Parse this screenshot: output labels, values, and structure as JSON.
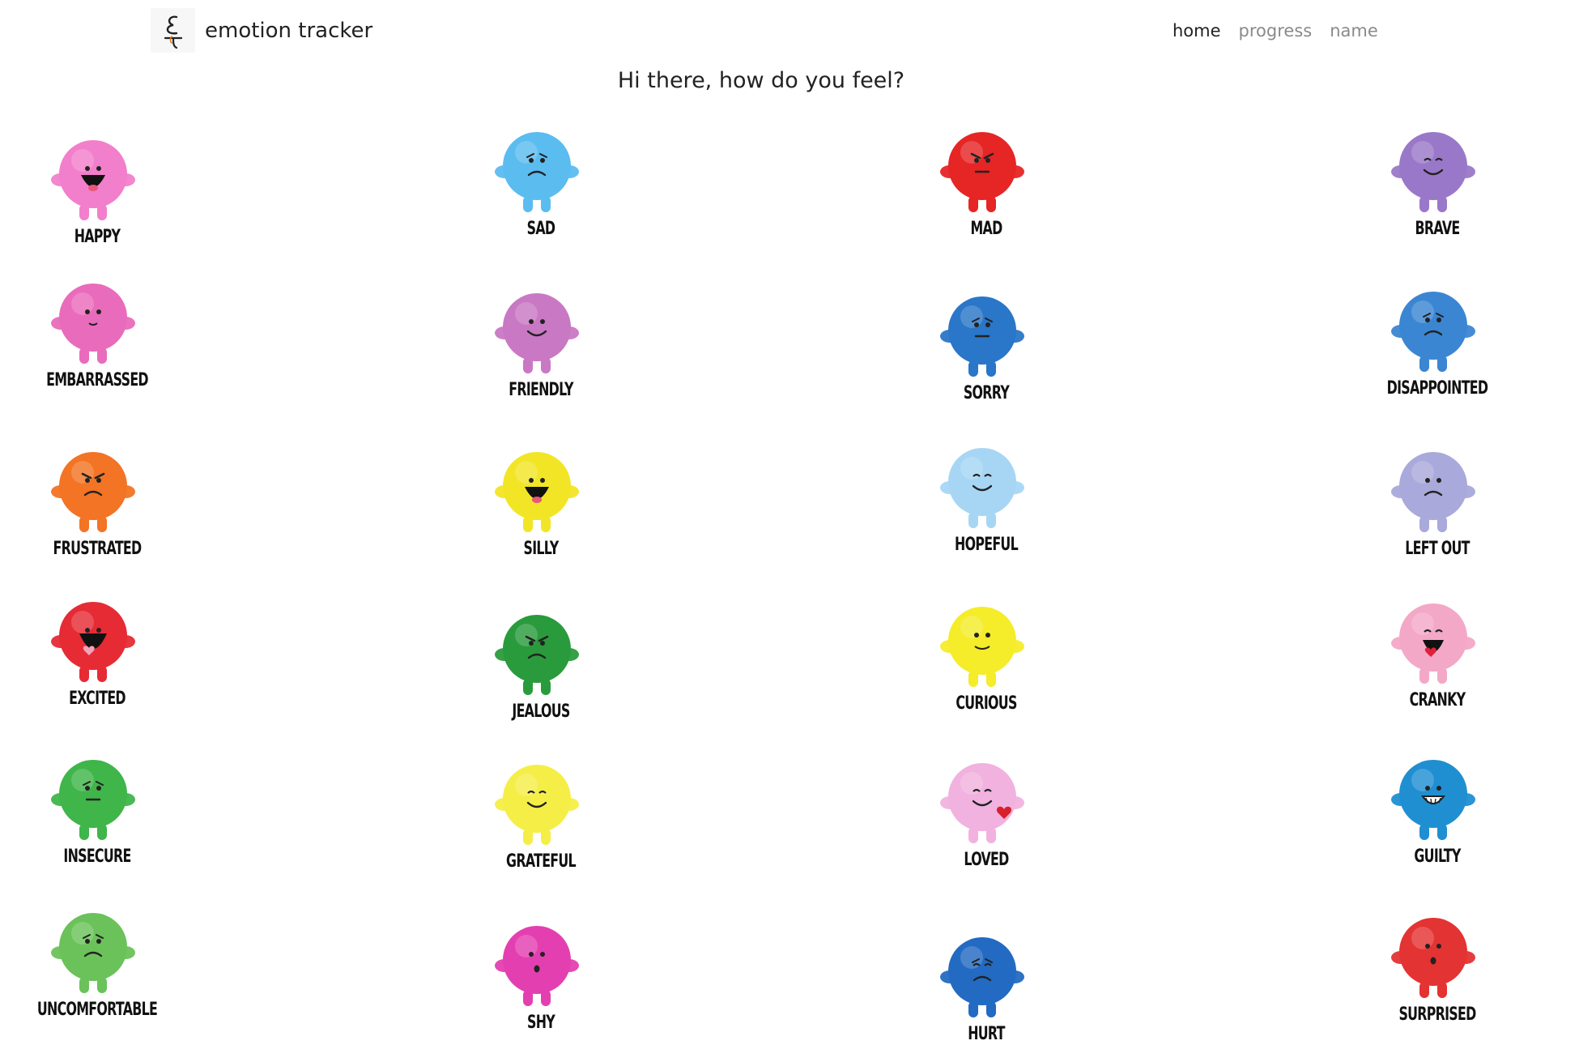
{
  "app": {
    "brand_name": "emotion tracker",
    "logo_glyph": "ε"
  },
  "nav": [
    {
      "label": "home",
      "active": true
    },
    {
      "label": "progress",
      "active": false
    },
    {
      "label": "name",
      "active": false
    }
  ],
  "greeting": "Hi there, how do you feel?",
  "emotions": [
    {
      "label": "HAPPY",
      "color": "#f27fcb",
      "icon": "happy-creature-icon"
    },
    {
      "label": "SAD",
      "color": "#5bbcf0",
      "icon": "sad-creature-icon"
    },
    {
      "label": "MAD",
      "color": "#e62525",
      "icon": "mad-creature-icon"
    },
    {
      "label": "BRAVE",
      "color": "#9a78c9",
      "icon": "brave-creature-icon"
    },
    {
      "label": "EMBARRASSED",
      "color": "#e96bbb",
      "icon": "embarrassed-creature-icon"
    },
    {
      "label": "FRIENDLY",
      "color": "#c978c4",
      "icon": "friendly-creature-icon"
    },
    {
      "label": "SORRY",
      "color": "#2a76c8",
      "icon": "sorry-creature-icon"
    },
    {
      "label": "DISAPPOINTED",
      "color": "#3b86d2",
      "icon": "disappointed-creature-icon"
    },
    {
      "label": "FRUSTRATED",
      "color": "#f27424",
      "icon": "frustrated-creature-icon"
    },
    {
      "label": "SILLY",
      "color": "#f2e526",
      "icon": "silly-creature-icon"
    },
    {
      "label": "HOPEFUL",
      "color": "#a7d6f5",
      "icon": "hopeful-creature-icon"
    },
    {
      "label": "LEFT OUT",
      "color": "#a9a9db",
      "icon": "left-out-creature-icon"
    },
    {
      "label": "EXCITED",
      "color": "#e62b35",
      "icon": "excited-creature-icon"
    },
    {
      "label": "JEALOUS",
      "color": "#2a9b3c",
      "icon": "jealous-creature-icon"
    },
    {
      "label": "CURIOUS",
      "color": "#f5ec2a",
      "icon": "curious-creature-icon"
    },
    {
      "label": "CRANKY",
      "color": "#f3a8c7",
      "icon": "cranky-creature-icon"
    },
    {
      "label": "INSECURE",
      "color": "#3fb54a",
      "icon": "insecure-creature-icon"
    },
    {
      "label": "GRATEFUL",
      "color": "#f5ee47",
      "icon": "grateful-creature-icon"
    },
    {
      "label": "LOVED",
      "color": "#f1b2df",
      "icon": "loved-creature-icon"
    },
    {
      "label": "GUILTY",
      "color": "#1f8fd2",
      "icon": "guilty-creature-icon"
    },
    {
      "label": "UNCOMFORTABLE",
      "color": "#6bc25a",
      "icon": "uncomfortable-creature-icon"
    },
    {
      "label": "SHY",
      "color": "#e43fb0",
      "icon": "shy-creature-icon"
    },
    {
      "label": "HURT",
      "color": "#236ac2",
      "icon": "hurt-creature-icon"
    },
    {
      "label": "SURPRISED",
      "color": "#e43333",
      "icon": "surprised-creature-icon"
    }
  ]
}
